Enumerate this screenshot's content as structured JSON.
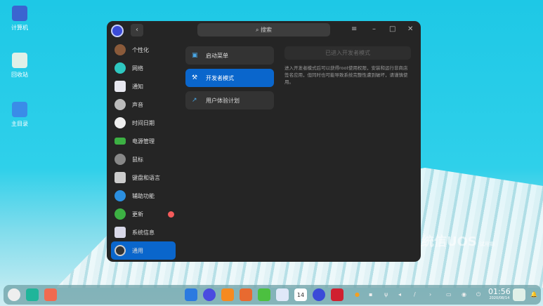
{
  "desktop": {
    "icons": [
      {
        "label": "计算机",
        "color": "#3b64d0"
      },
      {
        "label": "回收站",
        "color": "#e0f0e8"
      },
      {
        "label": "主目录",
        "color": "#3a8ce8"
      }
    ],
    "watermark": "统信UOS",
    "watermark_sub": "试用期"
  },
  "window": {
    "search_placeholder": "搜索",
    "sidebar": [
      {
        "label": "个性化",
        "color": "#8a5a3a"
      },
      {
        "label": "网络",
        "color": "#2ec7c0"
      },
      {
        "label": "通知",
        "color": "#e8e8f0"
      },
      {
        "label": "声音",
        "color": "#bbbbbb"
      },
      {
        "label": "时间日期",
        "color": "#eeeeee"
      },
      {
        "label": "电源管理",
        "color": "#3cb043"
      },
      {
        "label": "鼠标",
        "color": "#888888"
      },
      {
        "label": "键盘和语言",
        "color": "#cccccc"
      },
      {
        "label": "辅助功能",
        "color": "#2b8fe0"
      },
      {
        "label": "更新",
        "color": "#3cb043"
      },
      {
        "label": "系统信息",
        "color": "#d8d8e8"
      },
      {
        "label": "通用",
        "color": "#333333"
      }
    ],
    "update_badge": true,
    "active_sidebar": "通用",
    "menu": [
      {
        "label": "启动菜单",
        "icon": "▣"
      },
      {
        "label": "开发者模式",
        "icon": "⚒"
      },
      {
        "label": "用户体验计划",
        "icon": "↗"
      }
    ],
    "active_menu": "开发者模式",
    "dev_button": "已进入开发者模式",
    "dev_desc": "进入开发者模式后可以获得root使用权限，安装和运行非商店签名应用，但同时也可能导致系统完整性遭到破坏，请谨慎使用。"
  },
  "dock": {
    "time": "01:56",
    "date": "2020/08/14",
    "calendar_day": "14"
  },
  "colors": {
    "accent": "#0a66cc"
  }
}
